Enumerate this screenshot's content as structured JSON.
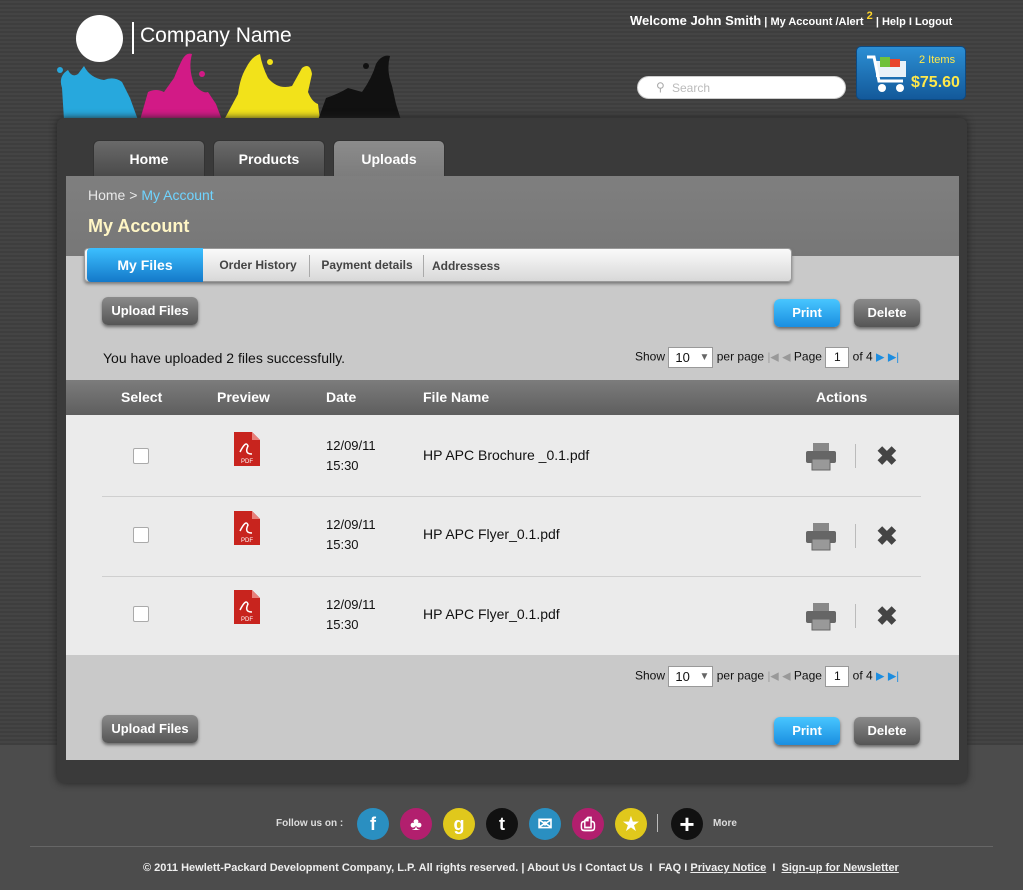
{
  "brand": {
    "company_name": "Company Name"
  },
  "topnav": {
    "welcome": "Welcome John Smith",
    "my_account": "My Account",
    "alert": "Alert",
    "alert_count": "2",
    "help": "Help",
    "logout": "Logout"
  },
  "search": {
    "placeholder": "Search"
  },
  "cart": {
    "items": "2 Items",
    "amount": "$75.60"
  },
  "main_tabs": [
    {
      "label": "Home"
    },
    {
      "label": "Products"
    },
    {
      "label": "Uploads",
      "active": true
    }
  ],
  "breadcrumb": {
    "home": "Home",
    "separator": ">",
    "current": "My Account"
  },
  "page_title": "My Account",
  "sub_tabs": [
    {
      "label": "My Files",
      "active": true
    },
    {
      "label": "Order History"
    },
    {
      "label": "Payment details"
    },
    {
      "label": "Addressess"
    }
  ],
  "actions": {
    "upload": "Upload Files",
    "print": "Print",
    "delete": "Delete"
  },
  "status_message": "You have uploaded 2 files successfully.",
  "pager": {
    "show": "Show",
    "per_page_value": "10",
    "per_page": "per page",
    "page": "Page",
    "current_page": "1",
    "of": "of 4"
  },
  "table": {
    "columns": [
      "Select",
      "Preview",
      "Date",
      "File Name",
      "Actions"
    ],
    "rows": [
      {
        "date": "12/09/11",
        "time": "15:30",
        "file": "HP APC Brochure _0.1.pdf"
      },
      {
        "date": "12/09/11",
        "time": "15:30",
        "file": "HP APC Flyer_0.1.pdf"
      },
      {
        "date": "12/09/11",
        "time": "15:30",
        "file": "HP APC Flyer_0.1.pdf"
      }
    ]
  },
  "footer": {
    "follow": "Follow us on :",
    "more": "More",
    "social": [
      {
        "icon": "facebook-icon",
        "glyph": "f",
        "color": "#2a8fc1"
      },
      {
        "icon": "myspace-icon",
        "glyph": "♣",
        "color": "#b21f6e"
      },
      {
        "icon": "google-icon",
        "glyph": "g",
        "color": "#e0c81c"
      },
      {
        "icon": "tumblr-icon",
        "glyph": "t",
        "color": "#111111"
      },
      {
        "icon": "email-icon",
        "glyph": "✉",
        "color": "#2a8fc1"
      },
      {
        "icon": "print-icon",
        "glyph": "⎙",
        "color": "#b21f6e"
      },
      {
        "icon": "favorite-icon",
        "glyph": "★",
        "color": "#e0c81c"
      }
    ],
    "copyright": "© 2011 Hewlett-Packard Development Company, L.P. All rights reserved.",
    "links": [
      "About Us",
      "Contact Us",
      "FAQ",
      "Privacy Notice",
      "Sign-up for Newsletter"
    ]
  },
  "colors": {
    "accent_blue": "#1a8ee0",
    "link_cyan": "#6fd4ff",
    "cart_yellow": "#ffe84a",
    "title_cream": "#fff6c5"
  }
}
